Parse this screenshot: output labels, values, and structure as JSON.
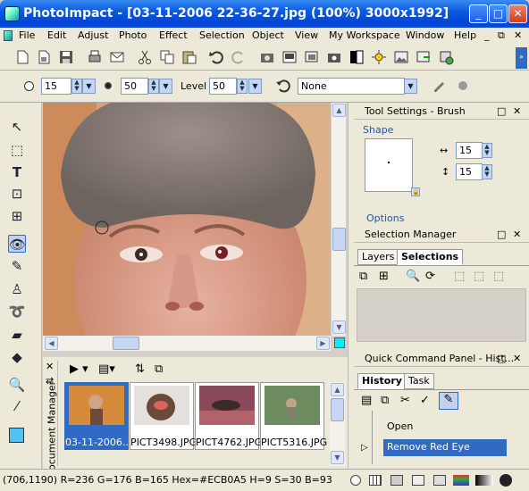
{
  "window": {
    "title": "PhotoImpact - [03-11-2006 22-36-27.jpg (100%) 3000x1992]",
    "min": "_",
    "max": "□",
    "close": "✕"
  },
  "menu": [
    "File",
    "Edit",
    "Adjust",
    "Photo",
    "Effect",
    "Selection",
    "Object",
    "View",
    "My Workspace",
    "Window",
    "Help"
  ],
  "menu_controls": {
    "min": "_",
    "restore": "⧉",
    "close": "✕"
  },
  "options": {
    "size": "15",
    "soft": "50",
    "level_label": "Level",
    "level": "50",
    "preset": "None"
  },
  "right": {
    "tool_settings_title": "Tool Settings - Brush",
    "shape_label": "Shape",
    "width": "15",
    "height": "15",
    "options_label": "Options",
    "selection_manager_title": "Selection Manager",
    "tabs1": [
      "Layers",
      "Selections"
    ],
    "qcp_title": "Quick Command Panel - Hist...",
    "tabs2": [
      "History",
      "Task"
    ],
    "history": [
      "Open",
      "Remove Red Eye"
    ]
  },
  "docmanager": {
    "label": "Document Manager",
    "thumbs": [
      "03-11-2006...",
      "PICT3498.JPG",
      "PICT4762.JPG",
      "PICT5316.JPG"
    ]
  },
  "status": {
    "text": "(706,1190) R=236 G=176 B=165  Hex=#ECB0A5   H=9 S=30 B=93"
  },
  "colors": {
    "title": "#0a5ae0",
    "selection": "#316ac5",
    "foreground": "#4fc3f7"
  }
}
